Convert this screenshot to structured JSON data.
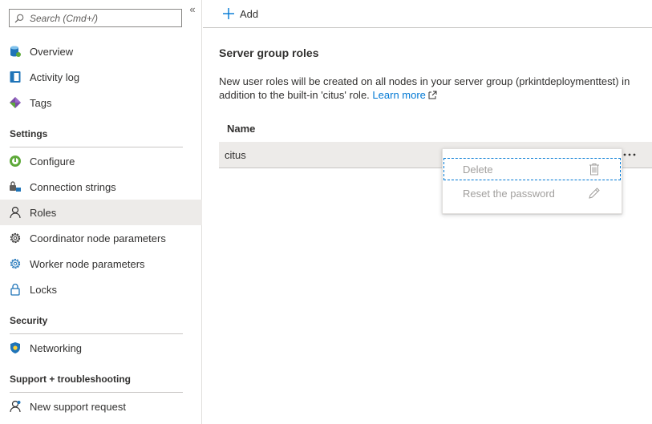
{
  "sidebar": {
    "search": {
      "placeholder": "Search (Cmd+/)"
    },
    "collapse_label": "«",
    "top_items": [
      {
        "label": "Overview",
        "icon": "database-icon"
      },
      {
        "label": "Activity log",
        "icon": "activity-log-icon"
      },
      {
        "label": "Tags",
        "icon": "tag-icon"
      }
    ],
    "sections": [
      {
        "title": "Settings",
        "items": [
          {
            "label": "Configure",
            "icon": "configure-icon"
          },
          {
            "label": "Connection strings",
            "icon": "connection-strings-icon"
          },
          {
            "label": "Roles",
            "icon": "person-icon",
            "active": true
          },
          {
            "label": "Coordinator node parameters",
            "icon": "gear-icon"
          },
          {
            "label": "Worker node parameters",
            "icon": "gear-icon"
          },
          {
            "label": "Locks",
            "icon": "lock-icon"
          }
        ]
      },
      {
        "title": "Security",
        "items": [
          {
            "label": "Networking",
            "icon": "shield-icon"
          }
        ]
      },
      {
        "title": "Support + troubleshooting",
        "items": [
          {
            "label": "New support request",
            "icon": "support-person-icon"
          }
        ]
      }
    ]
  },
  "toolbar": {
    "add_label": "Add"
  },
  "main": {
    "title": "Server group roles",
    "description": "New user roles will be created on all nodes in your server group (prkintdeploymenttest) in addition to the built-in 'citus' role.",
    "learn_more": "Learn more",
    "table": {
      "columns": [
        "Name"
      ],
      "rows": [
        {
          "name": "citus"
        }
      ]
    }
  },
  "context_menu": {
    "items": [
      {
        "label": "Delete",
        "icon": "trash-icon"
      },
      {
        "label": "Reset the password",
        "icon": "pencil-icon"
      }
    ]
  },
  "colors": {
    "accent": "#0078d4",
    "selected_bg": "#edebe9",
    "disabled_text": "#a19f9d"
  }
}
